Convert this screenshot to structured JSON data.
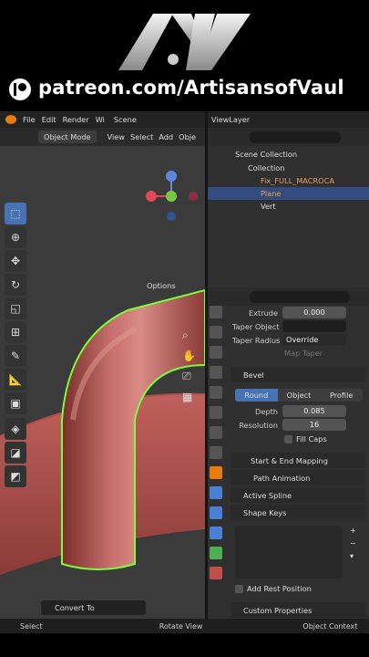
{
  "banner": {
    "url": "patreon.com/ArtisansofVaul"
  },
  "topbar": {
    "menus": [
      "File",
      "Edit",
      "Render",
      "Wi"
    ],
    "scene": "Scene",
    "view_layer": "ViewLayer"
  },
  "viewport_header": {
    "mode": "Object Mode",
    "menus": [
      "View",
      "Select",
      "Add",
      "Obje"
    ],
    "options": "Options"
  },
  "gizmo": {
    "z": "Z",
    "x": "X",
    "y": "Y"
  },
  "outliner": {
    "title": "Scene Collection",
    "rows": [
      {
        "label": "Collection"
      },
      {
        "label": "Fix_FULL_MACROCA"
      },
      {
        "label": "Plane"
      },
      {
        "label": "Vert"
      }
    ]
  },
  "properties": {
    "extrude_label": "Extrude",
    "extrude_value": "0.000",
    "taper_object_label": "Taper Object",
    "taper_radius_label": "Taper Radius",
    "taper_radius_value": "Override",
    "map_taper": "Map Taper",
    "bevel": "Bevel",
    "bevel_tabs": [
      "Round",
      "Object",
      "Profile"
    ],
    "depth_label": "Depth",
    "depth_value": "0.085",
    "resolution_label": "Resolution",
    "resolution_value": "16",
    "fill_caps": "Fill Caps",
    "start_end": "Start & End Mapping",
    "path_animation": "Path Animation",
    "active_spline": "Active Spline",
    "shape_keys": "Shape Keys",
    "add_rest": "Add Rest Position",
    "custom_props": "Custom Properties"
  },
  "convert_to": "Convert To",
  "status": {
    "select": "Select",
    "rotate": "Rotate View",
    "context": "Object Context"
  },
  "colors": {
    "accent": "#4772b3",
    "mesh": "#b85a57",
    "outline": "#7cfc3a",
    "blender_orange": "#e87d0d"
  }
}
